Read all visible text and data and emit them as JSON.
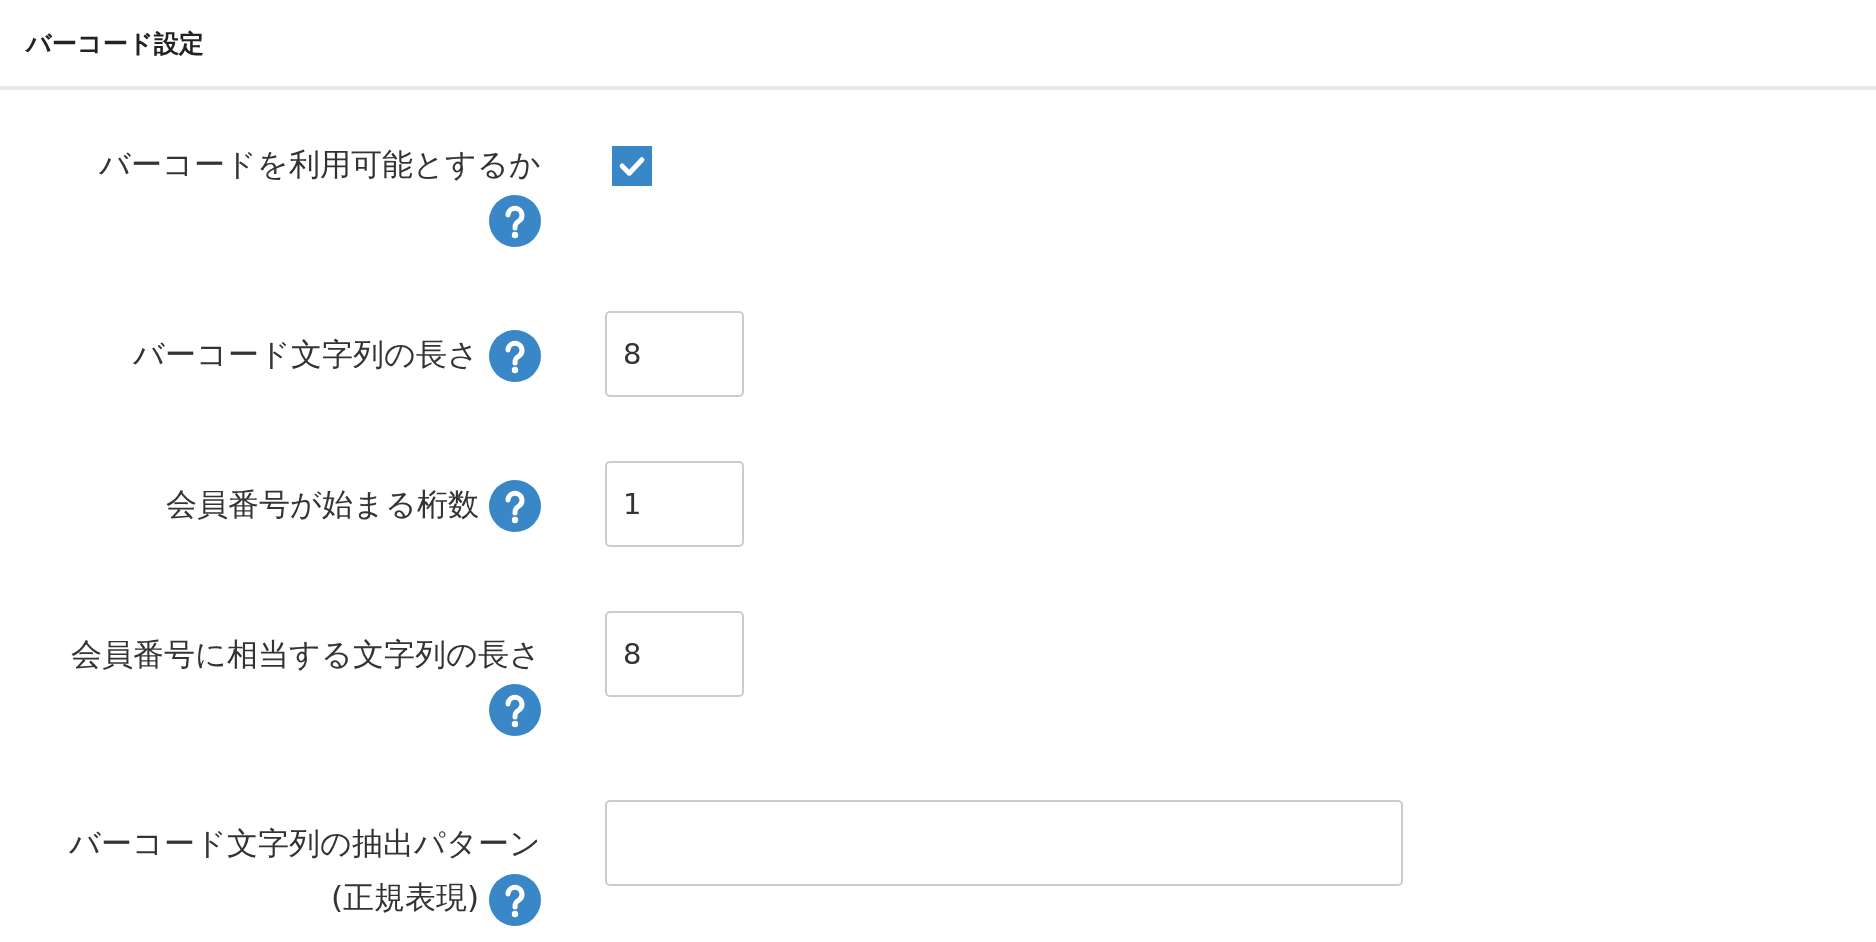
{
  "header": {
    "title": "バーコード設定"
  },
  "fields": [
    {
      "kind": "checkbox",
      "label": "バーコードを利用可能とするか",
      "checked": true
    },
    {
      "kind": "text",
      "label": "バーコード文字列の長さ",
      "value": "8"
    },
    {
      "kind": "text",
      "label": "会員番号が始まる桁数",
      "value": "1"
    },
    {
      "kind": "text",
      "label": "会員番号に相当する文字列の長さ",
      "value": "8"
    },
    {
      "kind": "wide_text",
      "label": "バーコード文字列の抽出パターン",
      "note": "(正規表現)"
    }
  ]
}
